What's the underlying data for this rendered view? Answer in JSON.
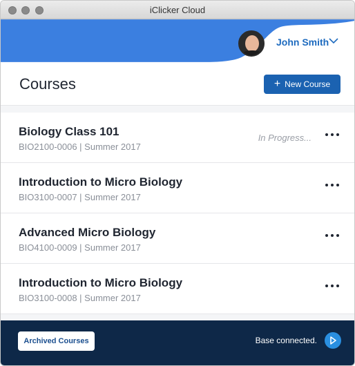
{
  "window": {
    "title": "iClicker Cloud"
  },
  "header": {
    "user_name": "John Smith",
    "brand_color": "#3b7fe0"
  },
  "courses_section": {
    "title": "Courses",
    "new_course_label": "New Course"
  },
  "courses": [
    {
      "name": "Biology Class 101",
      "meta": "BIO2100-0006 | Summer 2017",
      "status": "In Progress..."
    },
    {
      "name": "Introduction to Micro Biology",
      "meta": "BIO3100-0007 | Summer 2017",
      "status": ""
    },
    {
      "name": "Advanced Micro Biology",
      "meta": "BIO4100-0009 | Summer 2017",
      "status": ""
    },
    {
      "name": "Introduction to Micro Biology",
      "meta": "BIO3100-0008 | Summer 2017",
      "status": ""
    }
  ],
  "footer": {
    "archived_label": "Archived Courses",
    "base_status": "Base connected."
  }
}
